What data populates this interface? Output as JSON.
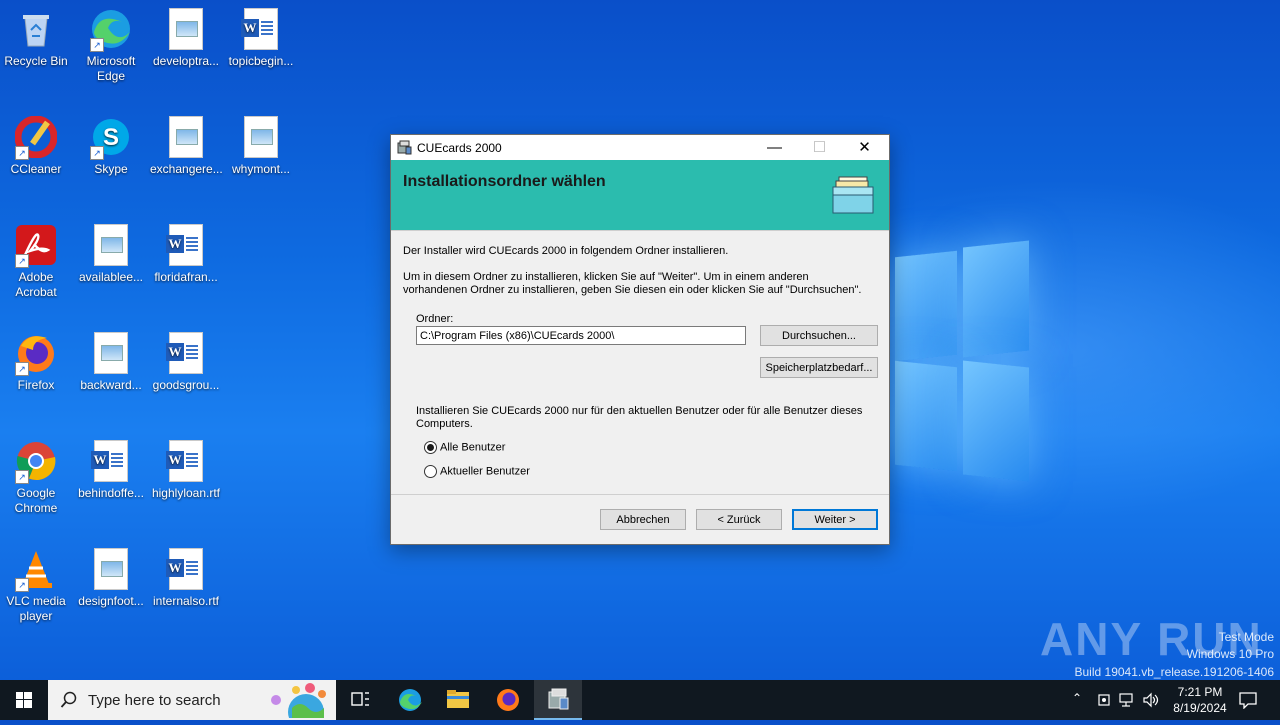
{
  "desktop": {
    "icons": [
      {
        "label": "Recycle Bin",
        "icon": "recycle-bin-icon"
      },
      {
        "label": "Microsoft Edge",
        "icon": "edge-icon"
      },
      {
        "label": "developtra...",
        "icon": "image-file-icon"
      },
      {
        "label": "topicbegin...",
        "icon": "word-doc-icon"
      },
      {
        "label": "CCleaner",
        "icon": "ccleaner-icon"
      },
      {
        "label": "Skype",
        "icon": "skype-icon"
      },
      {
        "label": "exchangere...",
        "icon": "image-file-icon"
      },
      {
        "label": "whymont...",
        "icon": "image-file-icon"
      },
      {
        "label": "Adobe Acrobat",
        "icon": "acrobat-icon"
      },
      {
        "label": "availablee...",
        "icon": "image-file-icon"
      },
      {
        "label": "floridafran...",
        "icon": "word-doc-icon"
      },
      {
        "label": "Firefox",
        "icon": "firefox-icon"
      },
      {
        "label": "backward...",
        "icon": "image-file-icon"
      },
      {
        "label": "goodsgrou...",
        "icon": "word-doc-icon"
      },
      {
        "label": "Google Chrome",
        "icon": "chrome-icon"
      },
      {
        "label": "behindoffe...",
        "icon": "word-doc-icon"
      },
      {
        "label": "highlyloan.rtf",
        "icon": "word-doc-icon"
      },
      {
        "label": "VLC media player",
        "icon": "vlc-icon"
      },
      {
        "label": "designfoot...",
        "icon": "image-file-icon"
      },
      {
        "label": "internalso.rtf",
        "icon": "word-doc-icon"
      }
    ]
  },
  "dialog": {
    "title": "CUEcards 2000",
    "heading": "Installationsordner wählen",
    "intro": "Der Installer wird CUEcards 2000 in folgendem Ordner installieren.",
    "instructions": "Um in diesem Ordner zu installieren, klicken Sie auf \"Weiter\". Um in einem anderen vorhandenen Ordner zu installieren, geben Sie diesen ein oder klicken Sie auf \"Durchsuchen\".",
    "folder_label": "Ordner:",
    "folder_value": "C:\\Program Files (x86)\\CUEcards 2000\\",
    "browse_label": "Durchsuchen...",
    "disk_cost_label": "Speicherplatzbedarf...",
    "scope_question": "Installieren Sie CUEcards 2000 nur für den aktuellen Benutzer oder für alle Benutzer dieses Computers.",
    "radio_all": "Alle Benutzer",
    "radio_current": "Aktueller Benutzer",
    "selected_scope": "Alle Benutzer",
    "cancel_label": "Abbrechen",
    "back_label": "< Zurück",
    "next_label": "Weiter >"
  },
  "watermark": {
    "brand": "ANY RUN",
    "line1": "Test Mode",
    "line2": "Windows 10 Pro",
    "line3": "Build 19041.vb_release.191206-1406"
  },
  "taskbar": {
    "search_placeholder": "Type here to search",
    "time": "7:21 PM",
    "date": "8/19/2024"
  },
  "colors": {
    "banner": "#2bbcae",
    "desktop": "#0e6ae0",
    "taskbar": "#101820"
  }
}
